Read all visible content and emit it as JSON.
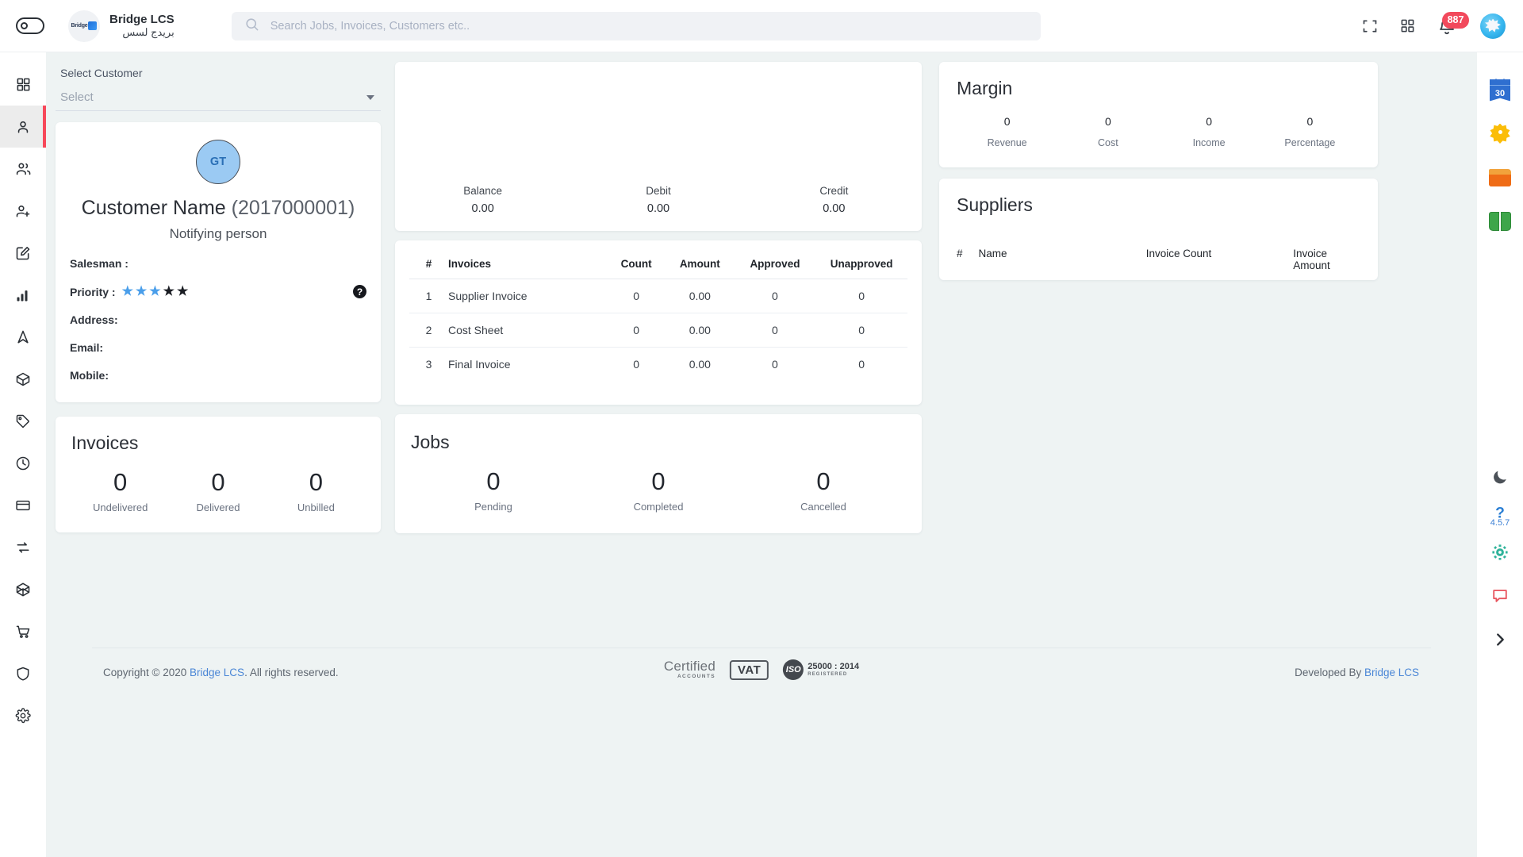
{
  "topbar": {
    "toggle_name": "sidebar-toggle",
    "brand": {
      "logo_text": "Bridge",
      "name_en": "Bridge LCS",
      "name_ar": "بريدج لسس"
    },
    "search": {
      "placeholder": "Search Jobs, Invoices, Customers etc..",
      "value": ""
    },
    "notification_count": "887",
    "icons": [
      "fullscreen-icon",
      "apps-grid-icon",
      "notification-bell-icon",
      "user-avatar"
    ]
  },
  "left_sidebar": {
    "items": [
      {
        "name": "dashboard-grid-icon",
        "active": false
      },
      {
        "name": "customer-person-icon",
        "active": true
      },
      {
        "name": "people-group-icon",
        "active": false
      },
      {
        "name": "add-person-icon",
        "active": false
      },
      {
        "name": "edit-note-icon",
        "active": false
      },
      {
        "name": "bar-chart-icon",
        "active": false
      },
      {
        "name": "navigation-arrow-icon",
        "active": false
      },
      {
        "name": "package-box-icon",
        "active": false
      },
      {
        "name": "price-tag-icon",
        "active": false
      },
      {
        "name": "clock-history-icon",
        "active": false
      },
      {
        "name": "credit-card-icon",
        "active": false
      },
      {
        "name": "sync-exchange-icon",
        "active": false
      },
      {
        "name": "cube-3d-icon",
        "active": false
      },
      {
        "name": "shopping-cart-icon",
        "active": false
      },
      {
        "name": "shield-security-icon",
        "active": false
      },
      {
        "name": "settings-gear-icon",
        "active": false
      }
    ]
  },
  "right_sidebar": {
    "calendar_day": "30",
    "version": "4.5.7",
    "items": [
      "calendar-30-icon",
      "star-badge-icon",
      "folder-icon",
      "open-book-icon",
      "dark-mode-moon-icon",
      "help-question-icon",
      "settings-gear-teal-icon",
      "chat-bubble-icon",
      "expand-chevron-right-icon"
    ]
  },
  "customer_panel": {
    "select_label": "Select Customer",
    "select_placeholder": "Select",
    "avatar_initials": "GT",
    "customer_name": "Customer Name",
    "customer_code": "(2017000001)",
    "notifying_person": "Notifying person",
    "fields": [
      {
        "label": "Salesman :",
        "value": ""
      },
      {
        "label": "Address",
        "value": ":"
      },
      {
        "label": "Email",
        "value": ":"
      },
      {
        "label": "Mobile",
        "value": ":"
      }
    ],
    "priority_label": "Priority :",
    "priority_filled": 3,
    "priority_total": 5,
    "help_icon_text": "?"
  },
  "invoices_panel": {
    "title": "Invoices",
    "stats": [
      {
        "num": "0",
        "cap": "Undelivered"
      },
      {
        "num": "0",
        "cap": "Delivered"
      },
      {
        "num": "0",
        "cap": "Unbilled"
      }
    ]
  },
  "balance_panel": {
    "items": [
      {
        "label": "Balance",
        "value": "0.00"
      },
      {
        "label": "Debit",
        "value": "0.00"
      },
      {
        "label": "Credit",
        "value": "0.00"
      }
    ]
  },
  "invoice_table": {
    "headers": [
      "#",
      "Invoices",
      "Count",
      "Amount",
      "Approved",
      "Unapproved"
    ],
    "rows": [
      {
        "idx": "1",
        "name": "Supplier Invoice",
        "count": "0",
        "amount": "0.00",
        "approved": "0",
        "unapproved": "0"
      },
      {
        "idx": "2",
        "name": "Cost Sheet",
        "count": "0",
        "amount": "0.00",
        "approved": "0",
        "unapproved": "0"
      },
      {
        "idx": "3",
        "name": "Final Invoice",
        "count": "0",
        "amount": "0.00",
        "approved": "0",
        "unapproved": "0"
      }
    ]
  },
  "jobs_panel": {
    "title": "Jobs",
    "stats": [
      {
        "num": "0",
        "cap": "Pending"
      },
      {
        "num": "0",
        "cap": "Completed"
      },
      {
        "num": "0",
        "cap": "Cancelled"
      }
    ]
  },
  "margin_panel": {
    "title": "Margin",
    "stats": [
      {
        "num": "0",
        "cap": "Revenue"
      },
      {
        "num": "0",
        "cap": "Cost"
      },
      {
        "num": "0",
        "cap": "Income"
      },
      {
        "num": "0",
        "cap": "Percentage"
      }
    ]
  },
  "suppliers_panel": {
    "title": "Suppliers",
    "headers": [
      "#",
      "Name",
      "Invoice Count",
      "Invoice Amount"
    ],
    "rows": []
  },
  "footer": {
    "copyright_pre": "Copyright © 2020 ",
    "copyright_link": "Bridge LCS",
    "copyright_post": ". All rights reserved.",
    "badges": {
      "certified_main": "Certified",
      "certified_sub": "ACCOUNTS",
      "vat": "VAT",
      "iso_mark": "ISO",
      "iso_standard": "25000 : 2014",
      "iso_sub": "REGISTERED"
    },
    "developed_pre": "Developed By ",
    "developed_link": "Bridge LCS"
  },
  "colors": {
    "accent_red": "#f7485a",
    "link_blue": "#4a86d6",
    "star_blue": "#4a9eea",
    "page_bg": "#eef3f3",
    "badge_red": "#f2495c"
  }
}
